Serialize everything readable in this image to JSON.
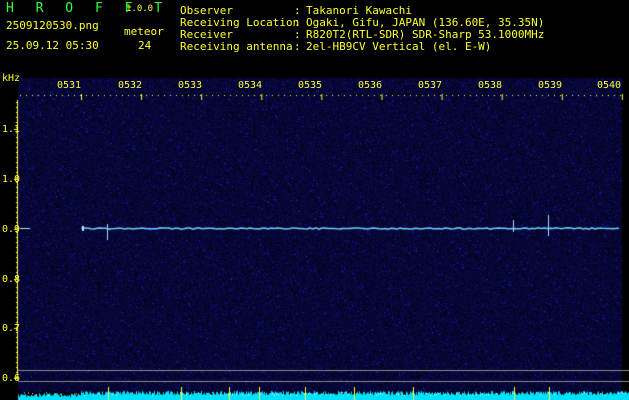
{
  "app": {
    "logo": "H R O F F T",
    "version": "1.0.0",
    "filename": "2509120530.png",
    "datetime": "25.09.12 05:30",
    "meteor_label": "meteor",
    "meteor_count": "24"
  },
  "info": {
    "labels": [
      "Observer",
      "Receiving Location",
      "Receiver",
      "Receiving antenna"
    ],
    "colons": [
      ":",
      ":",
      ":",
      ":"
    ],
    "values": [
      "Takanori Kawachi",
      "Ogaki, Gifu, JAPAN (136.60E, 35.35N)",
      "R820T2(RTL-SDR) SDR-Sharp 53.1000MHz",
      "2el-HB9CV Vertical (el. E-W)"
    ]
  },
  "axis": {
    "unit": "kHz",
    "time_ticks": [
      "0531",
      "0532",
      "0533",
      "0534",
      "0535",
      "0536",
      "0537",
      "0538",
      "0539",
      "0540"
    ],
    "freq_ticks": [
      "1.1",
      "1.0",
      "0.9",
      "0.8",
      "0.7",
      "0.6"
    ]
  },
  "colors": {
    "background": "#000000",
    "header_green": "#33ff33",
    "axis_yellow": "#ffff33",
    "carrier": "#6fd0ff",
    "noise": "#14148a",
    "meter": "#00e0ff"
  }
}
